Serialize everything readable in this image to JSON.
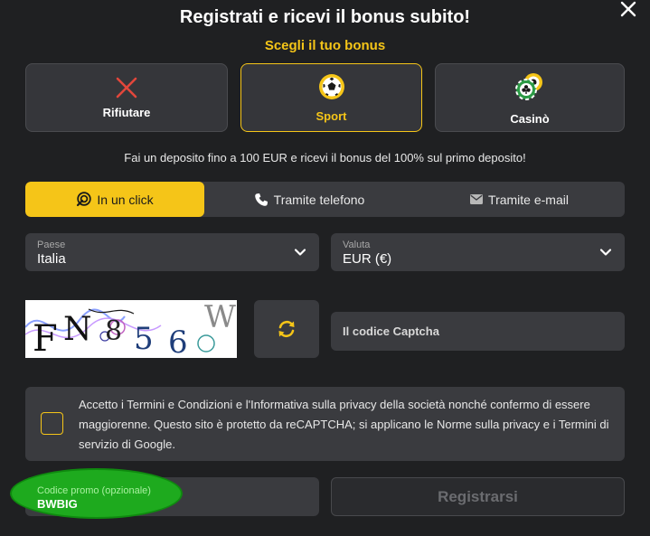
{
  "header": {
    "title": "Registrati e ricevi il bonus subito!",
    "subtitle": "Scegli il tuo bonus"
  },
  "bonus_options": [
    {
      "label": "Rifiutare",
      "icon": "x-icon"
    },
    {
      "label": "Sport",
      "icon": "soccer-ball-icon",
      "selected": true
    },
    {
      "label": "Casinò",
      "icon": "casino-chips-icon"
    }
  ],
  "deposit_info": "Fai un deposito fino a 100 EUR e ricevi il bonus del 100% sul primo deposito!",
  "tabs": [
    {
      "label": "In un click",
      "icon": "one-click-icon",
      "active": true
    },
    {
      "label": "Tramite telefono",
      "icon": "phone-icon"
    },
    {
      "label": "Tramite e-mail",
      "icon": "envelope-icon"
    }
  ],
  "country": {
    "label": "Paese",
    "value": "Italia"
  },
  "currency": {
    "label": "Valuta",
    "value": "EUR (€)"
  },
  "captcha": {
    "image_text": "FN856W",
    "placeholder": "Il codice Captcha"
  },
  "terms": {
    "text": "Accetto i Termini e Condizioni e l'Informativa sulla privacy della società nonché confermo di essere maggiorenne. Questo sito è protetto da reCAPTCHA; si applicano le Norme sulla privacy e i Termini di servizio di Google."
  },
  "promo": {
    "label": "Codice promo (opzionale)",
    "value": "BWBIG"
  },
  "register_label": "Registrarsi",
  "colors": {
    "accent": "#f5c518",
    "background": "#1f2022",
    "field": "#3a3b3f",
    "highlight": "#1eaa1e"
  }
}
